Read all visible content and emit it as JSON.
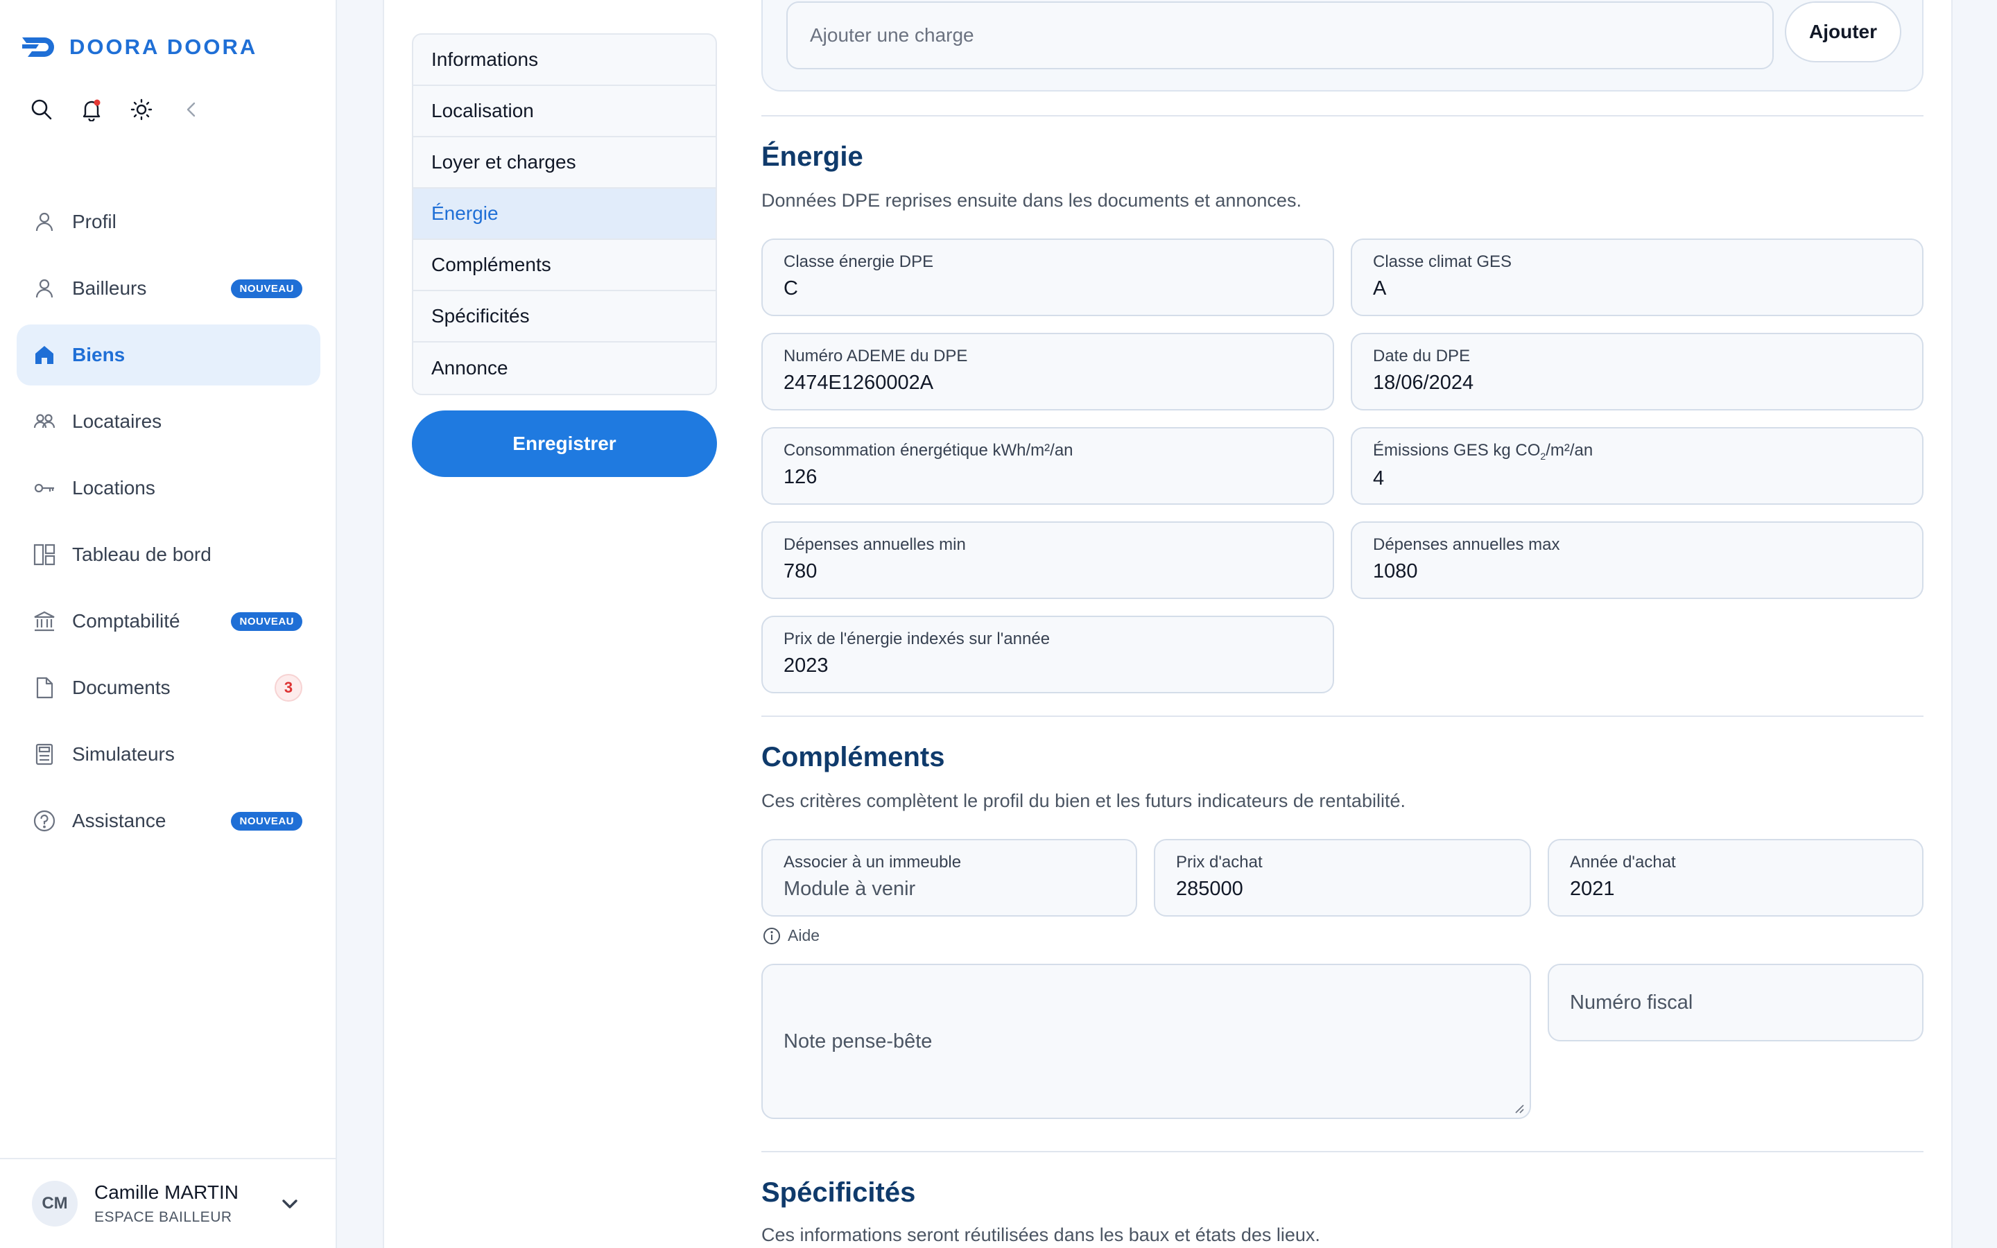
{
  "brand": {
    "name": "DOORA DOORA",
    "color": "#1f6fd6"
  },
  "sidebar": {
    "tools": [
      {
        "icon": "search-icon"
      },
      {
        "icon": "bell-icon"
      },
      {
        "icon": "sun-icon"
      },
      {
        "icon": "collapse-chevron-icon"
      }
    ],
    "items": [
      {
        "label": "Profil",
        "icon": "user-icon"
      },
      {
        "label": "Bailleurs",
        "icon": "user-icon",
        "badge": "NOUVEAU"
      },
      {
        "label": "Biens",
        "icon": "home-icon",
        "active": true
      },
      {
        "label": "Locataires",
        "icon": "users-icon"
      },
      {
        "label": "Locations",
        "icon": "key-icon"
      },
      {
        "label": "Tableau de bord",
        "icon": "dashboard-icon"
      },
      {
        "label": "Comptabilité",
        "icon": "bank-icon",
        "badge": "NOUVEAU"
      },
      {
        "label": "Documents",
        "icon": "document-icon",
        "count": "3"
      },
      {
        "label": "Simulateurs",
        "icon": "calculator-icon"
      },
      {
        "label": "Assistance",
        "icon": "help-icon",
        "badge": "NOUVEAU"
      }
    ],
    "user": {
      "initials": "CM",
      "name": "Camille MARTIN",
      "role": "ESPACE BAILLEUR"
    }
  },
  "section_nav": {
    "items": [
      "Informations",
      "Localisation",
      "Loyer et charges",
      "Énergie",
      "Compléments",
      "Spécificités",
      "Annonce"
    ],
    "active_index": 3,
    "save_label": "Enregistrer"
  },
  "charges": {
    "placeholder": "Ajouter une charge",
    "add_label": "Ajouter"
  },
  "energie": {
    "title": "Énergie",
    "description": "Données DPE reprises ensuite dans les documents et annonces.",
    "fields": {
      "classe_energie": {
        "label": "Classe énergie DPE",
        "value": "C"
      },
      "classe_climat": {
        "label": "Classe climat GES",
        "value": "A"
      },
      "numero_ademe": {
        "label": "Numéro ADEME du DPE",
        "value": "2474E1260002A"
      },
      "date_dpe": {
        "label": "Date du DPE",
        "value": "18/06/2024"
      },
      "consommation": {
        "label": "Consommation énergétique kWh/m²/an",
        "value": "126"
      },
      "emissions": {
        "label_prefix": "Émissions GES kg CO",
        "label_sub": "2",
        "label_suffix": "/m²/an",
        "value": "4"
      },
      "depenses_min": {
        "label": "Dépenses annuelles min",
        "value": "780"
      },
      "depenses_max": {
        "label": "Dépenses annuelles max",
        "value": "1080"
      },
      "prix_annee": {
        "label": "Prix de l'énergie indexés sur l'année",
        "value": "2023"
      }
    }
  },
  "complements": {
    "title": "Compléments",
    "description": "Ces critères complètent le profil du bien et les futurs indicateurs de rentabilité.",
    "fields": {
      "immeuble": {
        "label": "Associer à un immeuble",
        "value": "Module à venir"
      },
      "prix_achat": {
        "label": "Prix d'achat",
        "value": "285000"
      },
      "annee_achat": {
        "label": "Année d'achat",
        "value": "2021"
      }
    },
    "aide_label": "Aide",
    "note_placeholder": "Note pense-bête",
    "fiscal_placeholder": "Numéro fiscal"
  },
  "specificites": {
    "title": "Spécificités",
    "description": "Ces informations seront réutilisées dans les baux et états des lieux."
  }
}
